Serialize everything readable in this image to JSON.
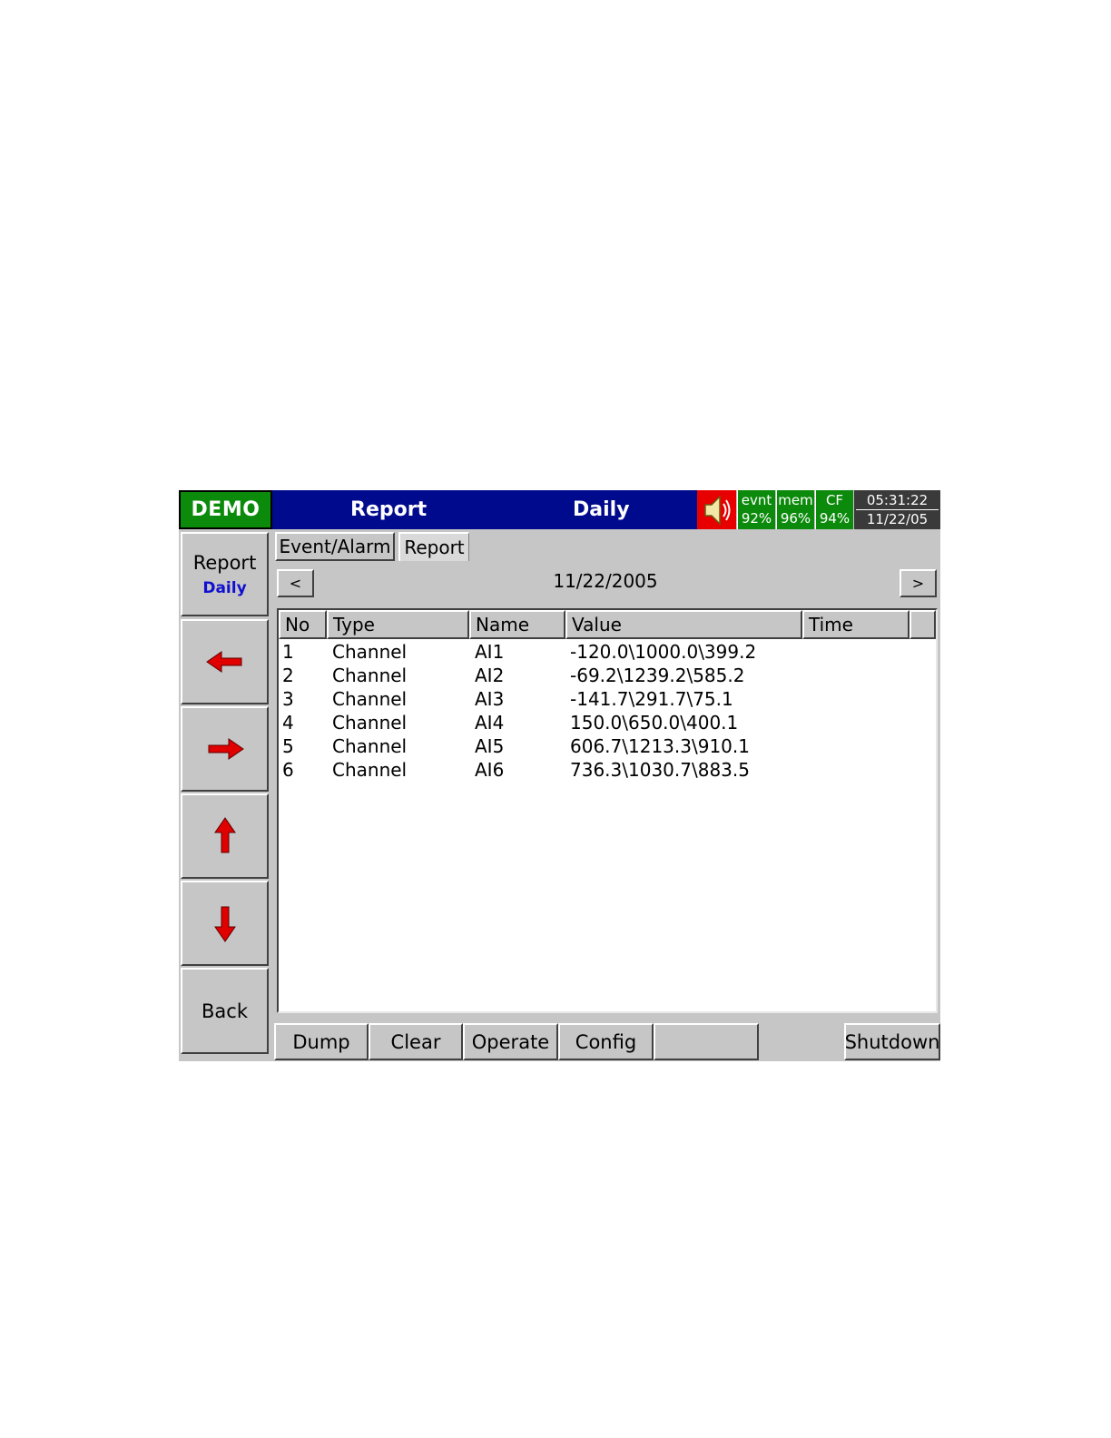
{
  "header": {
    "badge": "DEMO",
    "title": "Report",
    "subtitle": "Daily",
    "stats": [
      {
        "label": "evnt",
        "value": "92%"
      },
      {
        "label": "mem",
        "value": "96%"
      },
      {
        "label": "CF",
        "value": "94%"
      }
    ],
    "time": "05:31:22",
    "date": "11/22/05"
  },
  "nav": {
    "report_label": "Report",
    "report_sub": "Daily",
    "back_label": "Back"
  },
  "tabs": [
    {
      "label": "Event/Alarm"
    },
    {
      "label": "Report",
      "active": true
    }
  ],
  "date_nav": {
    "prev": "<",
    "next": ">",
    "date": "11/22/2005"
  },
  "table": {
    "columns": [
      "No",
      "Type",
      "Name",
      "Value",
      "Time"
    ],
    "rows": [
      {
        "no": "1",
        "type": "Channel",
        "name": "AI1",
        "value": "-120.0\\1000.0\\399.2",
        "time": ""
      },
      {
        "no": "2",
        "type": "Channel",
        "name": "AI2",
        "value": "-69.2\\1239.2\\585.2",
        "time": ""
      },
      {
        "no": "3",
        "type": "Channel",
        "name": "AI3",
        "value": "-141.7\\291.7\\75.1",
        "time": ""
      },
      {
        "no": "4",
        "type": "Channel",
        "name": "AI4",
        "value": "150.0\\650.0\\400.1",
        "time": ""
      },
      {
        "no": "5",
        "type": "Channel",
        "name": "AI5",
        "value": "606.7\\1213.3\\910.1",
        "time": ""
      },
      {
        "no": "6",
        "type": "Channel",
        "name": "AI6",
        "value": "736.3\\1030.7\\883.5",
        "time": ""
      }
    ]
  },
  "bottom": {
    "dump": "Dump",
    "clear": "Clear",
    "operate": "Operate",
    "config": "Config",
    "blank": "",
    "shutdown": "Shutdown"
  },
  "colors": {
    "title_bar": "#000a8c",
    "status_green": "#0b8a0b",
    "alert_red": "#e80000",
    "panel_gray": "#c6c6c6",
    "daily_blue": "#1010d0"
  },
  "icons": [
    "speaker-icon",
    "arrow-left-icon",
    "arrow-right-icon",
    "arrow-up-icon",
    "arrow-down-icon"
  ]
}
